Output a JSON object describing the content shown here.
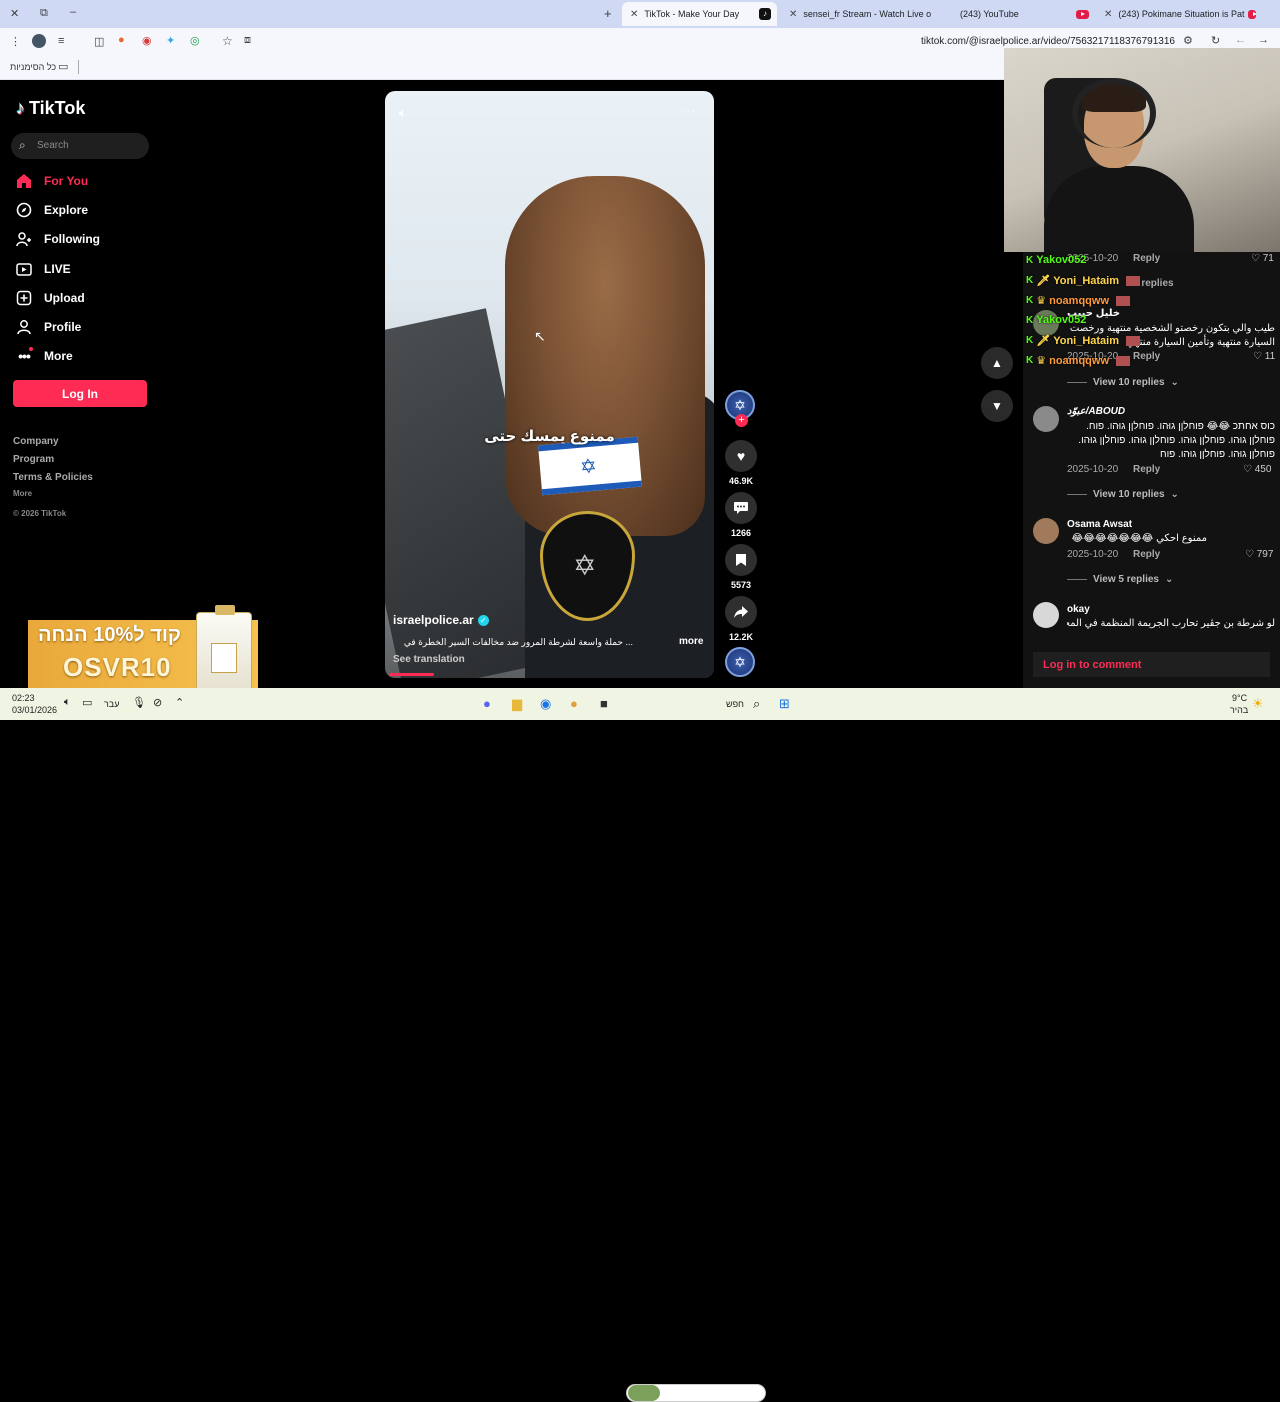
{
  "browser": {
    "tabs": [
      {
        "title": "TikTok - Make Your Day",
        "active": true
      },
      {
        "title": "sensei_fr Stream - Watch Live o"
      },
      {
        "title": "(243) YouTube"
      },
      {
        "title": "(243) Pokimane Situation is Pat"
      }
    ],
    "url": "tiktok.com/@israelpolice.ar/video/7563217118376791316",
    "bookmarks_label": "כל הסימניות"
  },
  "sidebar": {
    "logo": "TikTok",
    "search_placeholder": "Search",
    "nav": [
      {
        "label": "For You",
        "icon": "home-icon",
        "active": true
      },
      {
        "label": "Explore",
        "icon": "compass-icon"
      },
      {
        "label": "Following",
        "icon": "following-icon"
      },
      {
        "label": "LIVE",
        "icon": "live-icon"
      },
      {
        "label": "Upload",
        "icon": "upload-icon"
      },
      {
        "label": "Profile",
        "icon": "profile-icon"
      },
      {
        "label": "More",
        "icon": "more-icon"
      }
    ],
    "login": "Log In",
    "footer": [
      "Company",
      "Program",
      "Terms & Policies",
      "More",
      "© 2026 TikTok"
    ]
  },
  "video": {
    "subtitle": "ممنوع يمسك حتى",
    "author": "israelpolice.ar",
    "description": "... حملة واسعة لشرطة المرور ضد مخالفات السير الخطرة في",
    "more": "more",
    "see_translation": "See translation",
    "progress_fraction": 0.14
  },
  "actions": {
    "likes": "46.9K",
    "comments": "1266",
    "saves": "5573",
    "shares": "12.2K"
  },
  "chat_overlay": [
    {
      "user": "Yakov052",
      "color": "#53fc18"
    },
    {
      "user": "Yoni_Hataim",
      "color": "#ffd54a"
    },
    {
      "user": "noamqqww",
      "color": "#ff9a3c"
    },
    {
      "user": "Yakov052",
      "color": "#53fc18"
    },
    {
      "user": "Yoni_Hataim",
      "color": "#ffd54a"
    },
    {
      "user": "noamqqww",
      "color": "#ff9a3c"
    }
  ],
  "comments": {
    "top": {
      "reply": "Reply",
      "likes": "71",
      "ts": "2025-10-20",
      "replies": "1 replies"
    },
    "items": [
      {
        "user": "خليل حبيب",
        "text": "طيب والي بتكون رخصتو الشخصية منتهية ورخصت السيارة منتهية وتأمين السيارة منتهي",
        "date": "2025-10-20",
        "reply": "Reply",
        "likes": "11",
        "view": "View 10 replies"
      },
      {
        "user": "عبوّد/ABOUD",
        "text": "כוס אחתכ 😂😂 פוחלןן גוּהו. פוחלןן גוּהו. פוח. פוחלןן גוּהו. פוחלןן גוּהו. פוחלןן גוּהו. פוחלןן גוּהו. פוחלןן גוּהו. פוחלןן גוּהו. פוח",
        "date": "2025-10-20",
        "reply": "Reply",
        "likes": "450",
        "view": "View 10 replies"
      },
      {
        "user": "Osama Awsat",
        "text": "ممنوع احكي 😂😂😂😂😂😂😂",
        "date": "2025-10-20",
        "reply": "Reply",
        "likes": "797",
        "view": "View 5 replies"
      },
      {
        "user": "okay",
        "text": "لو شرطة بن جڤير تحارب الجريمة المنظمة في المجتمع"
      }
    ],
    "login_to_comment": "Log in to comment"
  },
  "promo": {
    "line1": "קוד ל10% הנחה",
    "line2": "OSVR10"
  },
  "taskbar": {
    "time": "02:23",
    "date": "03/01/2026",
    "lang": "עבר",
    "search": "חפש",
    "weather": "9°C",
    "weather_desc": "בהיר"
  }
}
